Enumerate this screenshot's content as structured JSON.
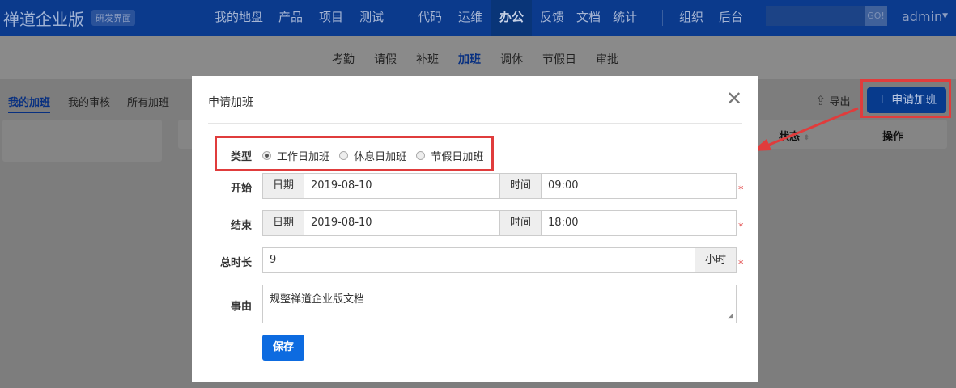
{
  "header": {
    "logo": "禅道企业版",
    "edition": "研发界面",
    "nav": [
      {
        "label": "我的地盘"
      },
      {
        "label": "产品"
      },
      {
        "label": "项目"
      },
      {
        "label": "测试"
      },
      {
        "label": "代码"
      },
      {
        "label": "运维"
      },
      {
        "label": "办公",
        "active": true
      },
      {
        "label": "反馈"
      },
      {
        "label": "文档"
      },
      {
        "label": "统计"
      },
      {
        "label": "组织"
      },
      {
        "label": "后台"
      }
    ],
    "search_button": "GO!",
    "user": "admin"
  },
  "subnav": [
    {
      "label": "考勤"
    },
    {
      "label": "请假"
    },
    {
      "label": "补班"
    },
    {
      "label": "加班",
      "active": true
    },
    {
      "label": "调休"
    },
    {
      "label": "节假日"
    },
    {
      "label": "审批"
    }
  ],
  "tabs": [
    {
      "label": "我的加班"
    },
    {
      "label": "我的审核"
    },
    {
      "label": "所有加班"
    }
  ],
  "toolbar": {
    "export": "导出",
    "add": "申请加班"
  },
  "table": {
    "columns": [
      "状态",
      "操作"
    ]
  },
  "modal": {
    "title": "申请加班",
    "type_label": "类型",
    "types": [
      "工作日加班",
      "休息日加班",
      "节假日加班"
    ],
    "selected_type": "工作日加班",
    "start_label": "开始",
    "end_label": "结束",
    "date_addon": "日期",
    "time_addon": "时间",
    "start_date": "2019-08-10",
    "start_time": "09:00",
    "end_date": "2019-08-10",
    "end_time": "18:00",
    "hours_label": "总时长",
    "hours": "9",
    "hours_unit": "小时",
    "reason_label": "事由",
    "reason": "规整禅道企业版文档",
    "save": "保存",
    "required_mark": "*"
  },
  "colors": {
    "brand": "#0b3a8c",
    "primary": "#0d6be0",
    "highlight": "#e03c3c"
  }
}
